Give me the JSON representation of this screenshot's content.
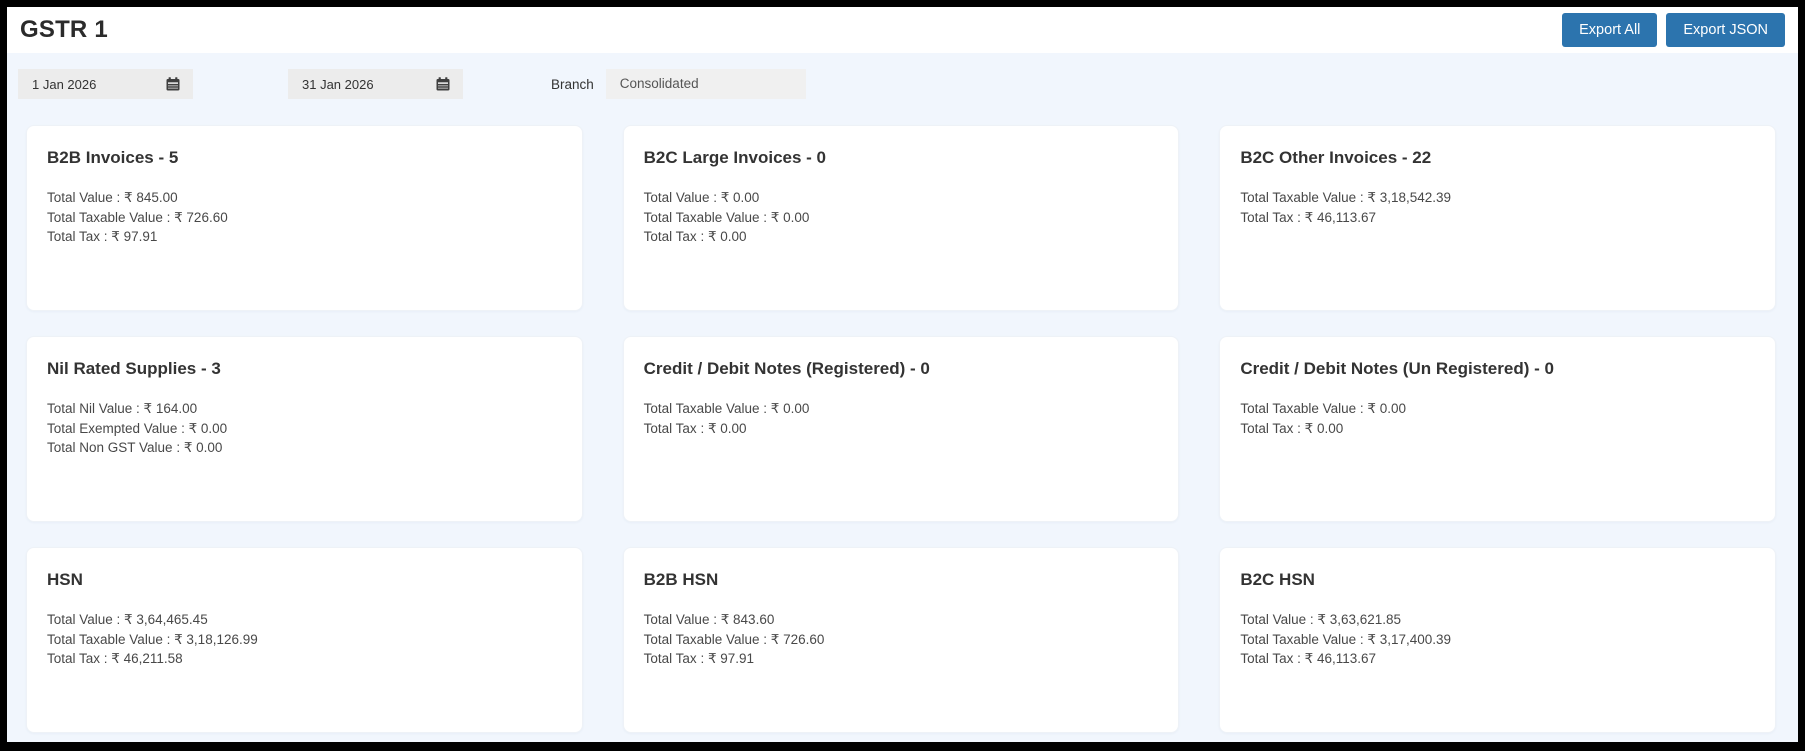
{
  "header": {
    "title": "GSTR 1",
    "export_all_label": "Export All",
    "export_json_label": "Export JSON"
  },
  "filters": {
    "from_date": "1 Jan 2026",
    "to_date": "31 Jan 2026",
    "branch_label": "Branch",
    "branch_value": "Consolidated"
  },
  "icons": {
    "from_date_icon": "calendar-icon",
    "to_date_icon": "calendar-icon"
  },
  "colors": {
    "accent_blue": "#2c74ae",
    "page_background": "#f1f6fd",
    "frame_border": "#000000",
    "card_background": "#ffffff"
  },
  "cards": [
    {
      "title": "B2B Invoices - 5",
      "lines": [
        "Total Value : ₹ 845.00",
        "Total Taxable Value : ₹ 726.60",
        "Total Tax : ₹ 97.91"
      ]
    },
    {
      "title": "B2C Large Invoices - 0",
      "lines": [
        "Total Value : ₹ 0.00",
        "Total Taxable Value : ₹ 0.00",
        "Total Tax : ₹ 0.00"
      ]
    },
    {
      "title": "B2C Other Invoices - 22",
      "lines": [
        "Total Taxable Value : ₹ 3,18,542.39",
        "Total Tax : ₹ 46,113.67"
      ]
    },
    {
      "title": "Nil Rated Supplies - 3",
      "lines": [
        "Total Nil Value : ₹ 164.00",
        "Total Exempted Value : ₹ 0.00",
        "Total Non GST Value : ₹ 0.00"
      ]
    },
    {
      "title": "Credit / Debit Notes (Registered) - 0",
      "lines": [
        "Total Taxable Value : ₹ 0.00",
        "Total Tax : ₹ 0.00"
      ]
    },
    {
      "title": "Credit / Debit Notes (Un Registered) - 0",
      "lines": [
        "Total Taxable Value : ₹ 0.00",
        "Total Tax : ₹ 0.00"
      ]
    },
    {
      "title": "HSN",
      "lines": [
        "Total Value : ₹ 3,64,465.45",
        "Total Taxable Value : ₹ 3,18,126.99",
        "Total Tax : ₹ 46,211.58"
      ]
    },
    {
      "title": "B2B HSN",
      "lines": [
        "Total Value : ₹ 843.60",
        "Total Taxable Value : ₹ 726.60",
        "Total Tax : ₹ 97.91"
      ]
    },
    {
      "title": "B2C HSN",
      "lines": [
        "Total Value : ₹ 3,63,621.85",
        "Total Taxable Value : ₹ 3,17,400.39",
        "Total Tax : ₹ 46,113.67"
      ]
    }
  ]
}
